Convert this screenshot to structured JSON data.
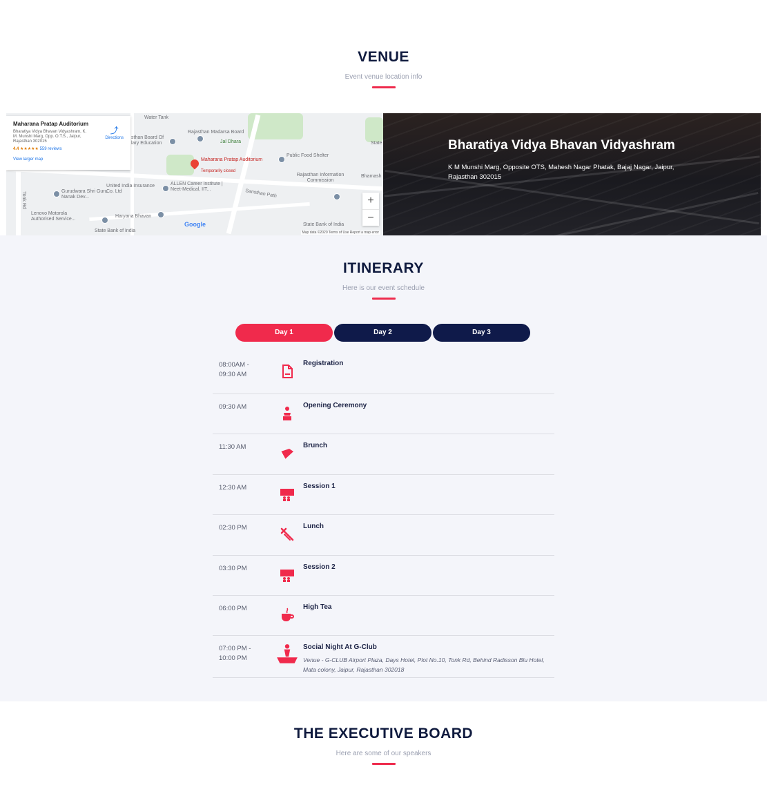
{
  "venue_section": {
    "title": "VENUE",
    "subtitle": "Event venue location info"
  },
  "map": {
    "place_name": "Maharana Pratap Auditorium",
    "place_address": "Bharatiya Vidya Bhavan Vidyashram, K. M. Munshi Marg, Opp. O.T.S., Jaipur, Rajasthan 302015",
    "rating": "4.4 ★★★★★",
    "reviews": "559 reviews",
    "larger_map": "View larger map",
    "directions": "Directions",
    "pin_label": "Maharana Pratap Auditorium",
    "pin_status": "Temporarily closed",
    "labels": {
      "madarsa": "Rajasthan Madarsa Board",
      "jal_dhara": "Jal Dhara",
      "board_of": "sthan Board Of",
      "mary_edu": "lary Education",
      "food": "Public Food Shelter",
      "info_comm": "Rajasthan Information Commission",
      "united": "United India Insurance Co. Ltd",
      "allen": "ALLEN Career Institute | Neet-Medical, IIT...",
      "gurudwara": "Gurudwara Shri Guru Nanak Dev...",
      "lenovo": "Lenovo Motorola Authorised Service...",
      "haryana": "Haryana Bhavan",
      "sbi1": "State Bank of India",
      "sbi2": "State Bank of India",
      "sansthan": "Sansthan Path",
      "tonk": "Tonk Rd",
      "water": "Water Tank",
      "state": "State",
      "bhamash": "Bhamash"
    },
    "google": "Google",
    "footer": "Map data ©2020   Terms of Use   Report a map error",
    "zoom_in": "+",
    "zoom_out": "−"
  },
  "venue": {
    "name": "Bharatiya Vidya Bhavan Vidyashram",
    "address": "K M Munshi Marg, Opposite OTS, Mahesh Nagar Phatak, Bajaj Nagar, Jaipur, Rajasthan 302015"
  },
  "itinerary_section": {
    "title": "ITINERARY",
    "subtitle": "Here is our event schedule"
  },
  "tabs": [
    {
      "label": "Day 1",
      "active": true
    },
    {
      "label": "Day 2",
      "active": false
    },
    {
      "label": "Day 3",
      "active": false
    }
  ],
  "schedule": [
    {
      "time": "08:00AM - 09:30 AM",
      "title": "Registration",
      "icon": "document-icon"
    },
    {
      "time": "09:30 AM",
      "title": "Opening Ceremony",
      "icon": "speaker-podium-icon"
    },
    {
      "time": "11:30 AM",
      "title": "Brunch",
      "icon": "bread-icon"
    },
    {
      "time": "12:30 AM",
      "title": "Session 1",
      "icon": "presentation-icon"
    },
    {
      "time": "02:30 PM",
      "title": "Lunch",
      "icon": "cutlery-icon"
    },
    {
      "time": "03:30 PM",
      "title": "Session 2",
      "icon": "presentation-icon"
    },
    {
      "time": "06:00 PM",
      "title": "High Tea",
      "icon": "teacup-icon"
    },
    {
      "time": "07:00 PM - 10:00 PM",
      "title": "Social Night At G-Club",
      "icon": "party-boat-icon",
      "description": "Venue - G-CLUB Airport Plaza, Days Hotel, Plot No.10, Tonk Rd, Behind Radisson Blu Hotel, Mata colony, Jaipur, Rajasthan 302018"
    }
  ],
  "board_section": {
    "title": "THE EXECUTIVE BOARD",
    "subtitle": "Here are some of our speakers"
  },
  "colors": {
    "accent": "#f02a4c",
    "navy": "#0f1a4a",
    "itinerary_bg": "#f4f5fa"
  }
}
